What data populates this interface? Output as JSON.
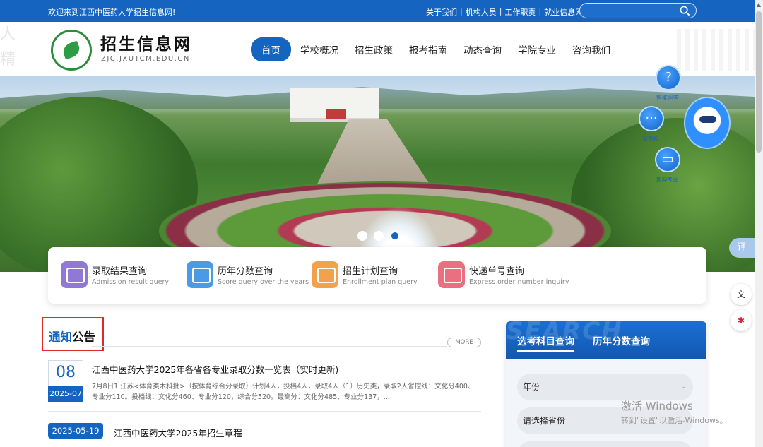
{
  "topbar": {
    "welcome": "欢迎来到江西中医药大学招生信息网!",
    "links": [
      "关于我们",
      "机构人员",
      "工作职责",
      "就业信息网"
    ],
    "search_placeholder": ""
  },
  "header": {
    "site_title": "招生信息网",
    "site_domain": "ZJC.JXUTCM.EDU.CN",
    "nav": [
      {
        "label": "首页",
        "active": true
      },
      {
        "label": "学校概况"
      },
      {
        "label": "招生政策"
      },
      {
        "label": "报考指南"
      },
      {
        "label": "动态查询"
      },
      {
        "label": "学院专业"
      },
      {
        "label": "咨询我们"
      }
    ]
  },
  "assistant": {
    "buttons": [
      {
        "label": "智能问答",
        "icon": "question-icon"
      },
      {
        "label": "留言板",
        "icon": "chat-icon"
      },
      {
        "label": "查询专业",
        "icon": "book-icon"
      }
    ]
  },
  "side_tools": {
    "translate_label": "译"
  },
  "banner": {
    "slide_count": 3,
    "active_slide": 3
  },
  "quick_queries": [
    {
      "title": "录取结果查询",
      "subtitle": "Admission result query",
      "icon": "admission-result-icon",
      "color": "#7b61c9"
    },
    {
      "title": "历年分数查询",
      "subtitle": "Score query over the years",
      "icon": "calendar-score-icon",
      "color": "#3d8fe0"
    },
    {
      "title": "招生计划查询",
      "subtitle": "Enrollment plan query",
      "icon": "enrollment-plan-icon",
      "color": "#f0953a"
    },
    {
      "title": "快递单号查询",
      "subtitle": "Express order number inquiry",
      "icon": "express-order-icon",
      "color": "#e65b6e"
    }
  ],
  "notice": {
    "title_a": "通知",
    "title_b": "公告",
    "more_label": "MORE",
    "items": [
      {
        "day": "08",
        "year_month": "2025-07",
        "title": "江西中医药大学2025年各省各专业录取分数一览表（实时更新)",
        "summary": "7月8日1.江苏<体育类木科批>（按体育综合分录取）计划4人，投档4人，录取4人（1）历史类，录取2人省控线：文化分400、专业分110。投档线：文化分460、专业分120，综合分520。最高分：文化分485、专业分137，..."
      },
      {
        "date": "2025-05-19",
        "title": "江西中医药大学2025年招生章程"
      }
    ]
  },
  "search_panel": {
    "watermark": "SEARCH",
    "tabs": [
      {
        "label": "选考科目查询",
        "active": true
      },
      {
        "label": "历年分数查询"
      }
    ],
    "selects": [
      {
        "value": "年份"
      },
      {
        "value": "请选择省份"
      }
    ]
  },
  "windows_activation": {
    "line1": "激活 Windows",
    "line2": "转到\"设置\"以激活 Windows。"
  },
  "colors": {
    "primary": "#1565c0",
    "highlight_border": "#e0272b"
  }
}
